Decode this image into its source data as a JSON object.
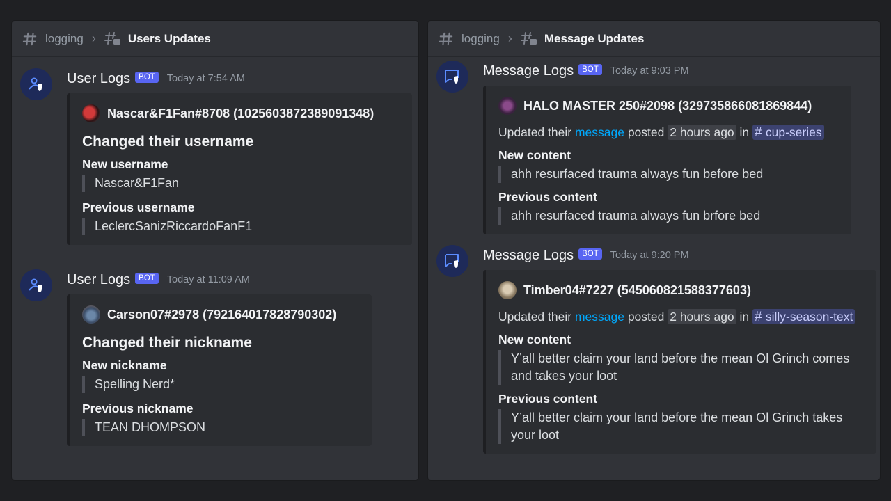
{
  "left": {
    "header": {
      "channel": "logging",
      "thread": "Users Updates"
    },
    "messages": [
      {
        "username": "User Logs",
        "badge": "BOT",
        "timestamp": "Today at 7:54 AM",
        "embed": {
          "author": "Nascar&F1Fan#8708 (1025603872389091348)",
          "title": "Changed their username",
          "fields": [
            {
              "label": "New username",
              "value": "Nascar&F1Fan"
            },
            {
              "label": "Previous username",
              "value": "LeclercSanizRiccardoFanF1"
            }
          ]
        }
      },
      {
        "username": "User Logs",
        "badge": "BOT",
        "timestamp": "Today at 11:09 AM",
        "embed": {
          "author": "Carson07#2978 (792164017828790302)",
          "title": "Changed their nickname",
          "fields": [
            {
              "label": "New nickname",
              "value": "Spelling Nerd*"
            },
            {
              "label": "Previous nickname",
              "value": "TEAN DHOMPSON"
            }
          ]
        }
      }
    ]
  },
  "right": {
    "header": {
      "channel": "logging",
      "thread": "Message Updates"
    },
    "messages": [
      {
        "username": "Message Logs",
        "badge": "BOT",
        "timestamp": "Today at 9:03 PM",
        "embed": {
          "author": "HALO MASTER 250#2098 (329735866081869844)",
          "desc": {
            "pre": "Updated their ",
            "link": "message",
            "mid": " posted ",
            "age": "2 hours ago",
            "in": " in ",
            "channel": "cup-series"
          },
          "fields": [
            {
              "label": "New content",
              "value": "ahh resurfaced trauma always fun before bed"
            },
            {
              "label": "Previous content",
              "value": "ahh resurfaced trauma always fun brfore bed"
            }
          ]
        }
      },
      {
        "username": "Message Logs",
        "badge": "BOT",
        "timestamp": "Today at 9:20 PM",
        "embed": {
          "author": "Timber04#7227 (545060821588377603)",
          "desc": {
            "pre": "Updated their ",
            "link": "message",
            "mid": " posted ",
            "age": "2 hours ago",
            "in": " in ",
            "channel": "silly-season-text"
          },
          "fields": [
            {
              "label": "New content",
              "value": "Y’all better claim your land before the mean Ol Grinch comes and takes your loot"
            },
            {
              "label": "Previous content",
              "value": "Y’all better claim your land before the mean Ol Grinch takes your loot"
            }
          ]
        }
      }
    ]
  },
  "icons": {
    "channel": "hashtag-icon",
    "thread": "thread-icon",
    "chevron": "chevron-right-icon",
    "user_logs_avatar": "user-shield-icon",
    "message_logs_avatar": "message-shield-icon"
  },
  "colors": {
    "background": "#1f2023",
    "panel": "#313338",
    "embed": "#2b2d31",
    "bot_badge": "#5865f2",
    "link": "#00a8fc",
    "mention": "#3c4270"
  }
}
